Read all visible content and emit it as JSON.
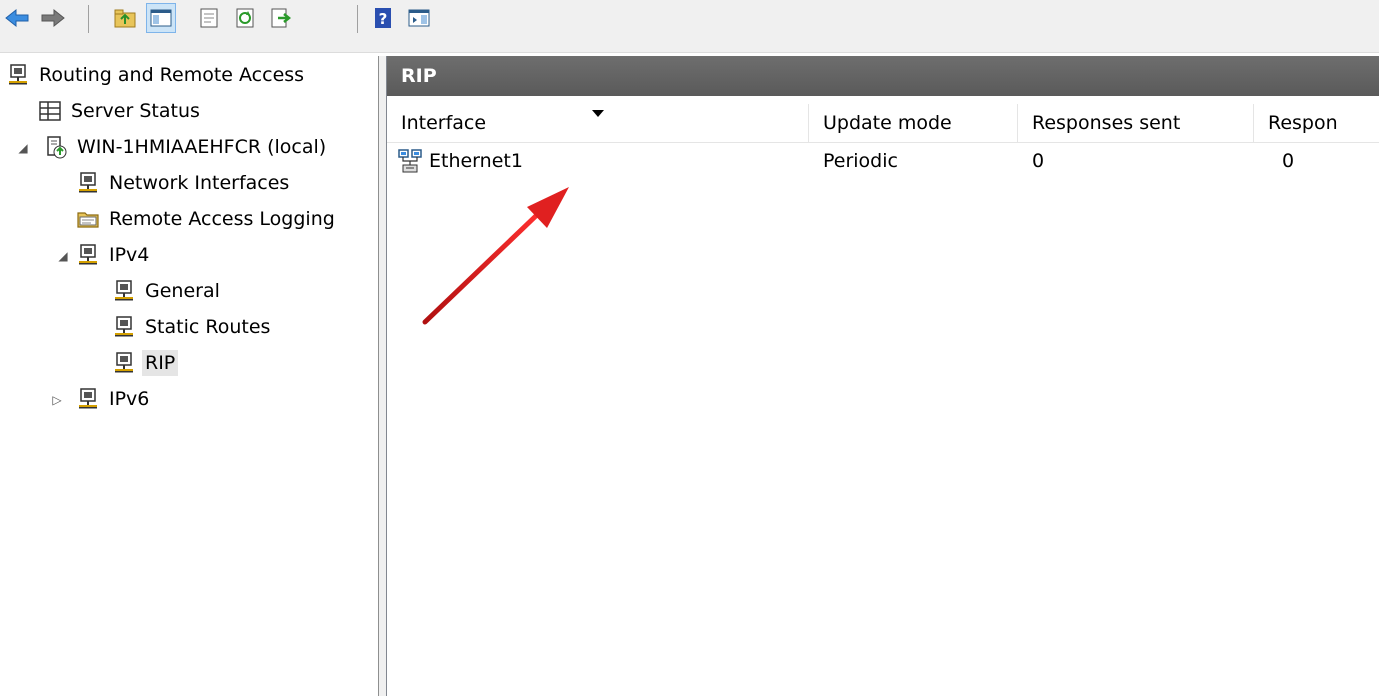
{
  "toolbar": {
    "buttons": [
      "back-icon",
      "forward-icon",
      "up-folder-icon",
      "show-hide-tree-icon",
      "properties-icon",
      "refresh-icon",
      "export-list-icon",
      "help-icon",
      "show-hide-action-pane-icon"
    ]
  },
  "tree": {
    "root": "Routing and Remote Access",
    "server_status": "Server Status",
    "server": "WIN-1HMIAAEHFCR (local)",
    "network_interfaces": "Network Interfaces",
    "remote_access_logging": "Remote Access Logging",
    "ipv4": "IPv4",
    "general": "General",
    "static_routes": "Static Routes",
    "rip": "RIP",
    "ipv6": "IPv6",
    "selected": "RIP"
  },
  "panel": {
    "title": "RIP",
    "columns": [
      "Interface",
      "Update mode",
      "Responses sent",
      "Respon"
    ],
    "rows": [
      {
        "interface": "Ethernet1",
        "update_mode": "Periodic",
        "responses_sent": "0",
        "responses_received": "0"
      }
    ]
  },
  "annotation": {
    "arrow_color": "#e02020"
  }
}
